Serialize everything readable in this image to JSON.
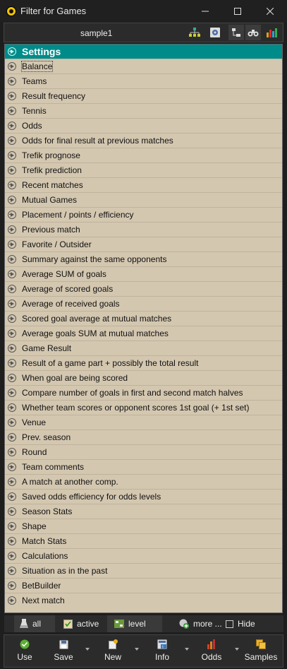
{
  "window": {
    "title": "Filter for Games"
  },
  "toolbar": {
    "sample_name": "sample1"
  },
  "list": {
    "header": "Settings",
    "items": [
      "Balance",
      "Teams",
      "Result frequency",
      "Tennis",
      "Odds",
      "Odds for final result at previous matches",
      "Trefik prognose",
      "Trefik prediction",
      "Recent matches",
      "Mutual Games",
      "Placement / points / efficiency",
      "Previous match",
      "Favorite / Outsider",
      "Summary against the same opponents",
      "Average SUM of goals",
      "Average of scored goals",
      "Average of received goals",
      "Scored goal average at mutual matches",
      "Average goals SUM at mutual matches",
      "Game Result",
      "Result of a game part + possibly the total result",
      "When goal are being scored",
      "Compare number of goals in first and second match halves",
      "Whether team scores or opponent scores 1st goal (+ 1st set)",
      "Venue",
      "Prev. season",
      "Round",
      "Team comments",
      "A match at another comp.",
      "Saved odds efficiency for odds levels",
      "Season Stats",
      "Shape",
      "Match Stats",
      "Calculations",
      "Situation as in the past",
      "BetBuilder",
      "Next match"
    ]
  },
  "filterbar": {
    "all": "all",
    "active": "active",
    "level": "level",
    "more": "more ...",
    "hide": "Hide"
  },
  "bottombar": {
    "use": "Use",
    "save": "Save",
    "new": "New",
    "info": "Info",
    "odds": "Odds",
    "samples": "Samples"
  }
}
